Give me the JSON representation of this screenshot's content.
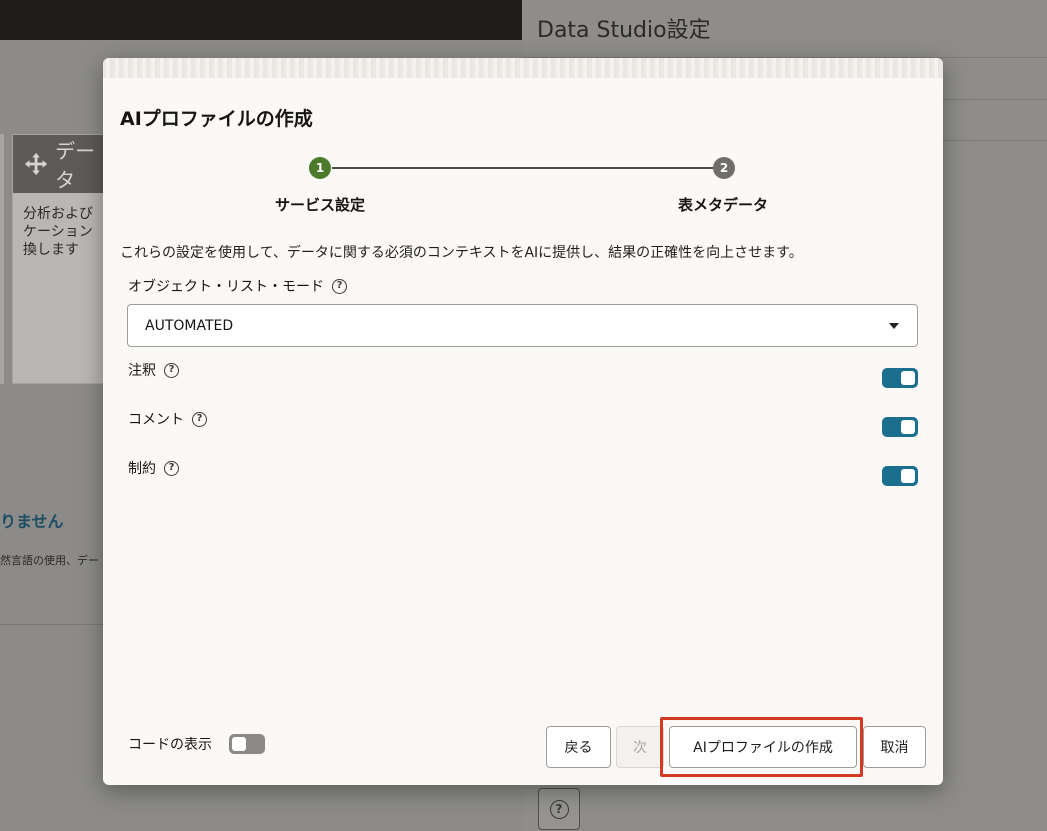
{
  "background": {
    "card_title": "データ",
    "card_text_lines": [
      "分析および",
      "ケーション",
      "換します"
    ],
    "notice_title": "りません",
    "notice_desc": "然言語の使用、デー"
  },
  "panel": {
    "title": "Data Studio設定",
    "help_glyph": "?"
  },
  "dialog": {
    "title": "AIプロファイルの作成",
    "steps": [
      {
        "number": "1",
        "label": "サービス設定",
        "status": "current",
        "color": "#4d7a2a"
      },
      {
        "number": "2",
        "label": "表メタデータ",
        "status": "upcoming",
        "color": "#6f6e6b"
      }
    ],
    "description": "これらの設定を使用して、データに関する必須のコンテキストをAIに提供し、結果の正確性を向上させます。",
    "object_list_mode": {
      "label": "オブジェクト・リスト・モード",
      "value": "AUTOMATED"
    },
    "toggles": [
      {
        "label": "注釈",
        "on": true
      },
      {
        "label": "コメント",
        "on": true
      },
      {
        "label": "制約",
        "on": true
      }
    ],
    "show_code": {
      "label": "コードの表示",
      "on": false
    },
    "buttons": {
      "back": "戻る",
      "next": "次",
      "create": "AIプロファイルの作成",
      "cancel": "取消"
    }
  },
  "colors": {
    "accent": "#1b6e8e",
    "step_complete": "#4d7a2a",
    "highlight": "#d33a1f"
  }
}
